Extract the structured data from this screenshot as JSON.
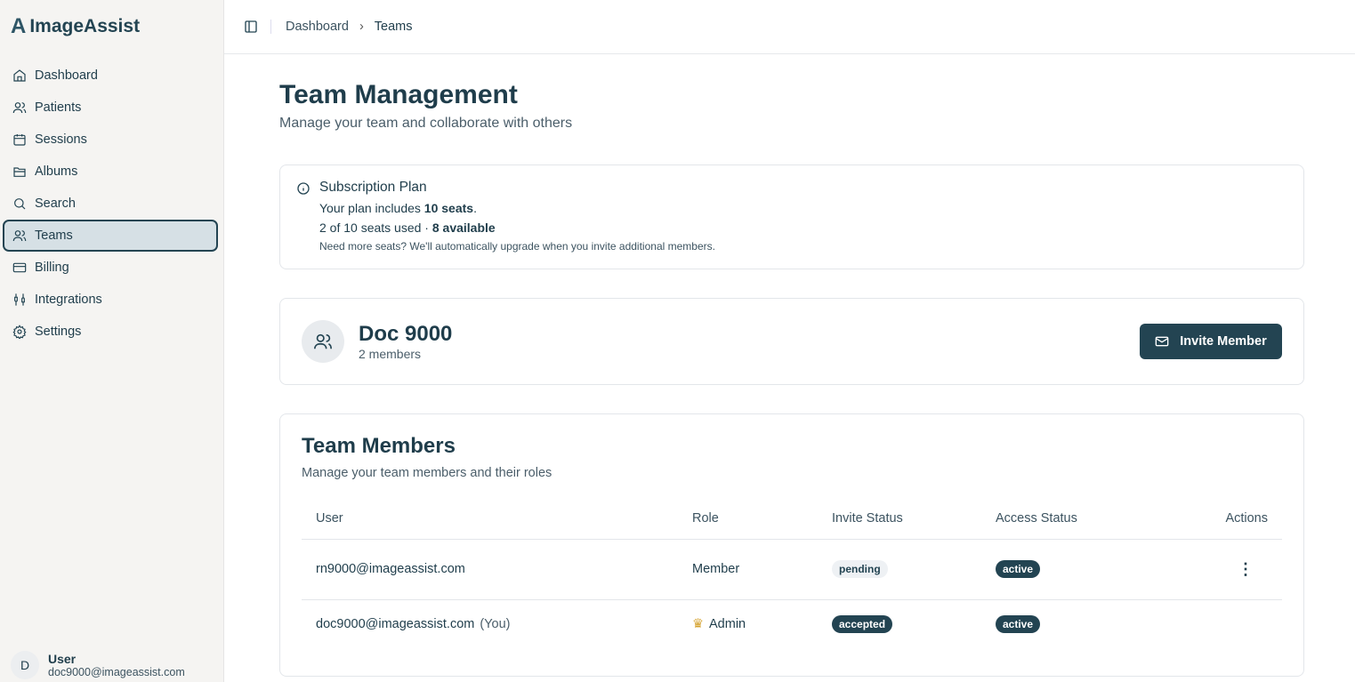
{
  "app": {
    "logo_mark": "A",
    "name": "ImageAssist"
  },
  "sidebar": {
    "items": [
      {
        "label": "Dashboard",
        "icon": "home-icon"
      },
      {
        "label": "Patients",
        "icon": "users-icon"
      },
      {
        "label": "Sessions",
        "icon": "calendar-icon"
      },
      {
        "label": "Albums",
        "icon": "folder-icon"
      },
      {
        "label": "Search",
        "icon": "search-icon"
      },
      {
        "label": "Teams",
        "icon": "users-icon",
        "active": true
      },
      {
        "label": "Billing",
        "icon": "credit-card-icon"
      },
      {
        "label": "Integrations",
        "icon": "plug-icon"
      },
      {
        "label": "Settings",
        "icon": "gear-icon"
      }
    ],
    "user": {
      "initial": "D",
      "name": "User",
      "email": "doc9000@imageassist.com"
    }
  },
  "breadcrumb": [
    "Dashboard",
    "Teams"
  ],
  "page": {
    "title": "Team Management",
    "subtitle": "Manage your team and collaborate with others"
  },
  "plan": {
    "title": "Subscription Plan",
    "includes_prefix": "Your plan includes ",
    "seats": "10 seats",
    "includes_suffix": ".",
    "used": "2 of 10 seats used · ",
    "available": "8 available",
    "note": "Need more seats? We'll automatically upgrade when you invite additional members."
  },
  "team": {
    "name": "Doc 9000",
    "count": "2 members",
    "invite_label": "Invite Member"
  },
  "members": {
    "title": "Team Members",
    "desc": "Manage your team members and their roles",
    "columns": [
      "User",
      "Role",
      "Invite Status",
      "Access Status",
      "Actions"
    ],
    "rows": [
      {
        "email": "rn9000@imageassist.com",
        "you": "",
        "role": "Member",
        "invite": "pending",
        "access": "active"
      },
      {
        "email": "doc9000@imageassist.com",
        "you": "(You)",
        "role": "Admin",
        "invite": "accepted",
        "access": "active"
      }
    ]
  },
  "colors": {
    "primary": "#234452",
    "admin_crown": "#d4a02a"
  }
}
